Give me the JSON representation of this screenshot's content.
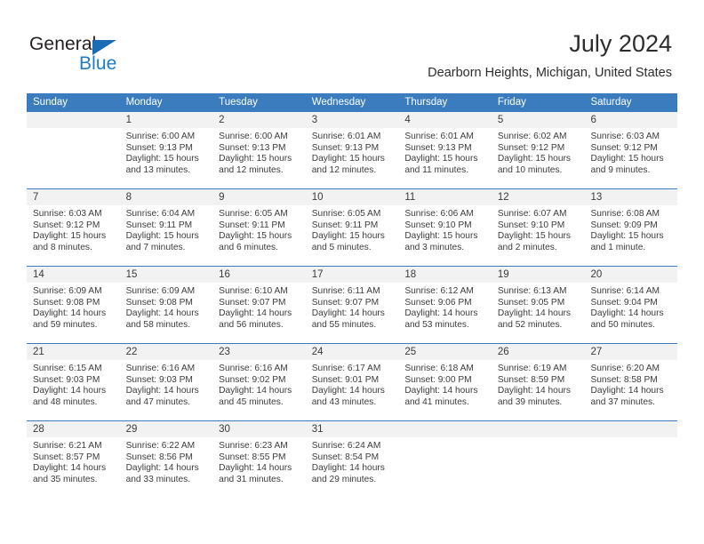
{
  "brand": {
    "name_part1": "General",
    "name_part2": "Blue",
    "accent_color": "#1f7cc6",
    "triangle_color": "#1c6cb5"
  },
  "header": {
    "title": "July 2024",
    "subtitle": "Dearborn Heights, Michigan, United States"
  },
  "theme": {
    "header_row_bg": "#3a7cbe",
    "daynum_band_bg": "#f2f2f2",
    "text_color": "#3c3c3c"
  },
  "weekdays": [
    "Sunday",
    "Monday",
    "Tuesday",
    "Wednesday",
    "Thursday",
    "Friday",
    "Saturday"
  ],
  "weeks": [
    {
      "days": [
        {
          "num": "",
          "sunrise": "",
          "sunset": "",
          "daylight1": "",
          "daylight2": ""
        },
        {
          "num": "1",
          "sunrise": "Sunrise: 6:00 AM",
          "sunset": "Sunset: 9:13 PM",
          "daylight1": "Daylight: 15 hours",
          "daylight2": "and 13 minutes."
        },
        {
          "num": "2",
          "sunrise": "Sunrise: 6:00 AM",
          "sunset": "Sunset: 9:13 PM",
          "daylight1": "Daylight: 15 hours",
          "daylight2": "and 12 minutes."
        },
        {
          "num": "3",
          "sunrise": "Sunrise: 6:01 AM",
          "sunset": "Sunset: 9:13 PM",
          "daylight1": "Daylight: 15 hours",
          "daylight2": "and 12 minutes."
        },
        {
          "num": "4",
          "sunrise": "Sunrise: 6:01 AM",
          "sunset": "Sunset: 9:13 PM",
          "daylight1": "Daylight: 15 hours",
          "daylight2": "and 11 minutes."
        },
        {
          "num": "5",
          "sunrise": "Sunrise: 6:02 AM",
          "sunset": "Sunset: 9:12 PM",
          "daylight1": "Daylight: 15 hours",
          "daylight2": "and 10 minutes."
        },
        {
          "num": "6",
          "sunrise": "Sunrise: 6:03 AM",
          "sunset": "Sunset: 9:12 PM",
          "daylight1": "Daylight: 15 hours",
          "daylight2": "and 9 minutes."
        }
      ]
    },
    {
      "days": [
        {
          "num": "7",
          "sunrise": "Sunrise: 6:03 AM",
          "sunset": "Sunset: 9:12 PM",
          "daylight1": "Daylight: 15 hours",
          "daylight2": "and 8 minutes."
        },
        {
          "num": "8",
          "sunrise": "Sunrise: 6:04 AM",
          "sunset": "Sunset: 9:11 PM",
          "daylight1": "Daylight: 15 hours",
          "daylight2": "and 7 minutes."
        },
        {
          "num": "9",
          "sunrise": "Sunrise: 6:05 AM",
          "sunset": "Sunset: 9:11 PM",
          "daylight1": "Daylight: 15 hours",
          "daylight2": "and 6 minutes."
        },
        {
          "num": "10",
          "sunrise": "Sunrise: 6:05 AM",
          "sunset": "Sunset: 9:11 PM",
          "daylight1": "Daylight: 15 hours",
          "daylight2": "and 5 minutes."
        },
        {
          "num": "11",
          "sunrise": "Sunrise: 6:06 AM",
          "sunset": "Sunset: 9:10 PM",
          "daylight1": "Daylight: 15 hours",
          "daylight2": "and 3 minutes."
        },
        {
          "num": "12",
          "sunrise": "Sunrise: 6:07 AM",
          "sunset": "Sunset: 9:10 PM",
          "daylight1": "Daylight: 15 hours",
          "daylight2": "and 2 minutes."
        },
        {
          "num": "13",
          "sunrise": "Sunrise: 6:08 AM",
          "sunset": "Sunset: 9:09 PM",
          "daylight1": "Daylight: 15 hours",
          "daylight2": "and 1 minute."
        }
      ]
    },
    {
      "days": [
        {
          "num": "14",
          "sunrise": "Sunrise: 6:09 AM",
          "sunset": "Sunset: 9:08 PM",
          "daylight1": "Daylight: 14 hours",
          "daylight2": "and 59 minutes."
        },
        {
          "num": "15",
          "sunrise": "Sunrise: 6:09 AM",
          "sunset": "Sunset: 9:08 PM",
          "daylight1": "Daylight: 14 hours",
          "daylight2": "and 58 minutes."
        },
        {
          "num": "16",
          "sunrise": "Sunrise: 6:10 AM",
          "sunset": "Sunset: 9:07 PM",
          "daylight1": "Daylight: 14 hours",
          "daylight2": "and 56 minutes."
        },
        {
          "num": "17",
          "sunrise": "Sunrise: 6:11 AM",
          "sunset": "Sunset: 9:07 PM",
          "daylight1": "Daylight: 14 hours",
          "daylight2": "and 55 minutes."
        },
        {
          "num": "18",
          "sunrise": "Sunrise: 6:12 AM",
          "sunset": "Sunset: 9:06 PM",
          "daylight1": "Daylight: 14 hours",
          "daylight2": "and 53 minutes."
        },
        {
          "num": "19",
          "sunrise": "Sunrise: 6:13 AM",
          "sunset": "Sunset: 9:05 PM",
          "daylight1": "Daylight: 14 hours",
          "daylight2": "and 52 minutes."
        },
        {
          "num": "20",
          "sunrise": "Sunrise: 6:14 AM",
          "sunset": "Sunset: 9:04 PM",
          "daylight1": "Daylight: 14 hours",
          "daylight2": "and 50 minutes."
        }
      ]
    },
    {
      "days": [
        {
          "num": "21",
          "sunrise": "Sunrise: 6:15 AM",
          "sunset": "Sunset: 9:03 PM",
          "daylight1": "Daylight: 14 hours",
          "daylight2": "and 48 minutes."
        },
        {
          "num": "22",
          "sunrise": "Sunrise: 6:16 AM",
          "sunset": "Sunset: 9:03 PM",
          "daylight1": "Daylight: 14 hours",
          "daylight2": "and 47 minutes."
        },
        {
          "num": "23",
          "sunrise": "Sunrise: 6:16 AM",
          "sunset": "Sunset: 9:02 PM",
          "daylight1": "Daylight: 14 hours",
          "daylight2": "and 45 minutes."
        },
        {
          "num": "24",
          "sunrise": "Sunrise: 6:17 AM",
          "sunset": "Sunset: 9:01 PM",
          "daylight1": "Daylight: 14 hours",
          "daylight2": "and 43 minutes."
        },
        {
          "num": "25",
          "sunrise": "Sunrise: 6:18 AM",
          "sunset": "Sunset: 9:00 PM",
          "daylight1": "Daylight: 14 hours",
          "daylight2": "and 41 minutes."
        },
        {
          "num": "26",
          "sunrise": "Sunrise: 6:19 AM",
          "sunset": "Sunset: 8:59 PM",
          "daylight1": "Daylight: 14 hours",
          "daylight2": "and 39 minutes."
        },
        {
          "num": "27",
          "sunrise": "Sunrise: 6:20 AM",
          "sunset": "Sunset: 8:58 PM",
          "daylight1": "Daylight: 14 hours",
          "daylight2": "and 37 minutes."
        }
      ]
    },
    {
      "days": [
        {
          "num": "28",
          "sunrise": "Sunrise: 6:21 AM",
          "sunset": "Sunset: 8:57 PM",
          "daylight1": "Daylight: 14 hours",
          "daylight2": "and 35 minutes."
        },
        {
          "num": "29",
          "sunrise": "Sunrise: 6:22 AM",
          "sunset": "Sunset: 8:56 PM",
          "daylight1": "Daylight: 14 hours",
          "daylight2": "and 33 minutes."
        },
        {
          "num": "30",
          "sunrise": "Sunrise: 6:23 AM",
          "sunset": "Sunset: 8:55 PM",
          "daylight1": "Daylight: 14 hours",
          "daylight2": "and 31 minutes."
        },
        {
          "num": "31",
          "sunrise": "Sunrise: 6:24 AM",
          "sunset": "Sunset: 8:54 PM",
          "daylight1": "Daylight: 14 hours",
          "daylight2": "and 29 minutes."
        },
        {
          "num": "",
          "sunrise": "",
          "sunset": "",
          "daylight1": "",
          "daylight2": ""
        },
        {
          "num": "",
          "sunrise": "",
          "sunset": "",
          "daylight1": "",
          "daylight2": ""
        },
        {
          "num": "",
          "sunrise": "",
          "sunset": "",
          "daylight1": "",
          "daylight2": ""
        }
      ]
    }
  ]
}
